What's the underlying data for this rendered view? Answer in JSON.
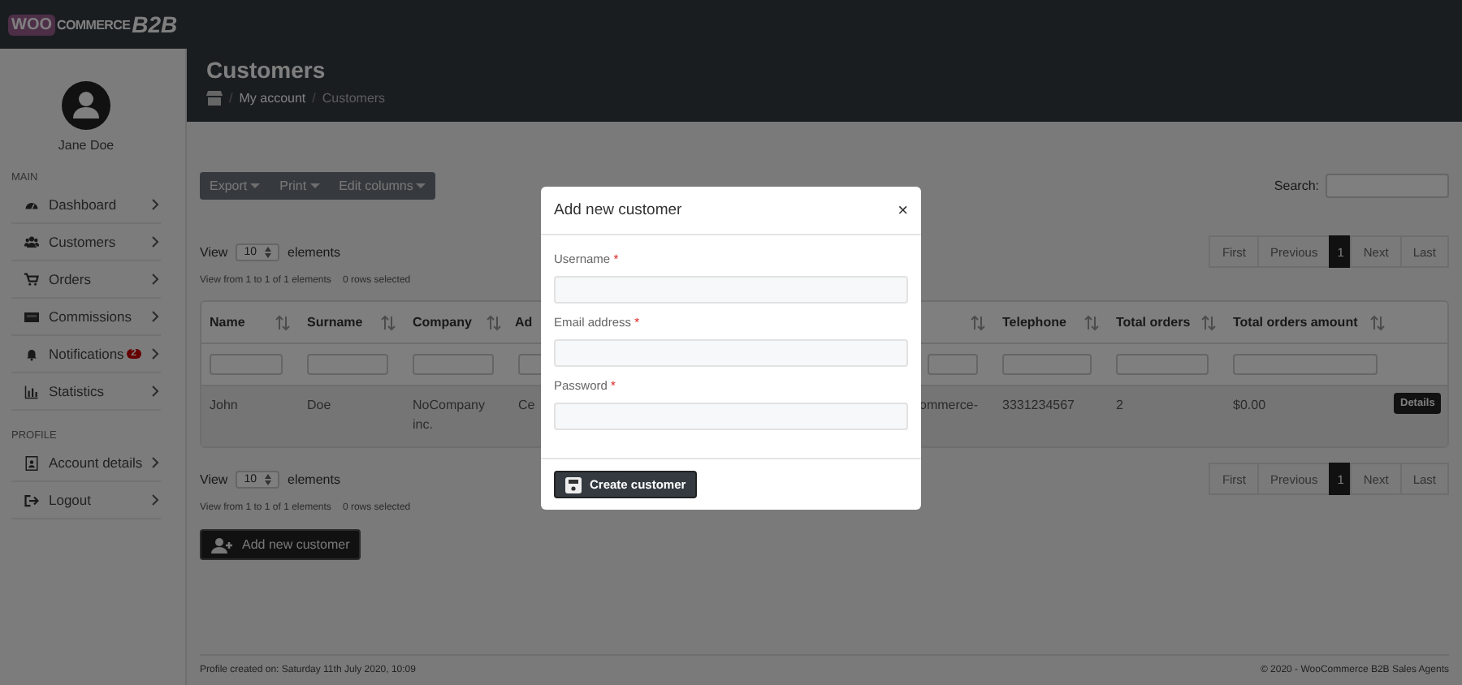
{
  "logo": {
    "brand": "WOO",
    "word": "COMMERCE",
    "suffix": "B2B"
  },
  "user": {
    "name": "Jane Doe"
  },
  "sidebar": {
    "sections": [
      {
        "label": "MAIN",
        "items": [
          {
            "label": "Dashboard"
          },
          {
            "label": "Customers"
          },
          {
            "label": "Orders"
          },
          {
            "label": "Commissions"
          },
          {
            "label": "Notifications",
            "badge": "2"
          },
          {
            "label": "Statistics"
          }
        ]
      },
      {
        "label": "PROFILE",
        "items": [
          {
            "label": "Account details"
          },
          {
            "label": "Logout"
          }
        ]
      }
    ]
  },
  "page_header": {
    "title": "Customers",
    "breadcrumb": [
      {
        "separator": "/",
        "label": "My account",
        "current": false
      },
      {
        "separator": "/",
        "label": "Customers",
        "current": true
      }
    ]
  },
  "toolbar": [
    "Export",
    "Print",
    "Edit columns"
  ],
  "search": {
    "label": "Search:"
  },
  "table_controls": [
    {
      "view": "View",
      "value": "10",
      "suffix": "elements",
      "info": "View from 1 to 1 of 1 elements",
      "selection": "0 rows selected",
      "pagination": [
        {
          "label": "First",
          "selected": false
        },
        {
          "label": "Previous",
          "selected": false
        },
        {
          "label": "1",
          "selected": true
        },
        {
          "label": "Next",
          "selected": false
        },
        {
          "label": "Last",
          "selected": false
        }
      ]
    },
    {
      "view": "View",
      "value": "10",
      "suffix": "elements",
      "info": "View from 1 to 1 of 1 elements",
      "selection": "0 rows selected",
      "pagination": [
        {
          "label": "First",
          "selected": false
        },
        {
          "label": "Previous",
          "selected": false
        },
        {
          "label": "1",
          "selected": true
        },
        {
          "label": "Next",
          "selected": false
        },
        {
          "label": "Last",
          "selected": false
        }
      ]
    }
  ],
  "table": {
    "columns": [
      {
        "label": "Name",
        "sortable": true
      },
      {
        "label": "Surname",
        "sortable": true
      },
      {
        "label": "Company",
        "sortable": true
      },
      {
        "label": "Ad",
        "sortable": false
      },
      {
        "sortable": true
      },
      {
        "label": "Telephone",
        "sortable": true
      },
      {
        "label": "Total orders",
        "sortable": true
      },
      {
        "label": "Total orders amount",
        "sortable": true
      }
    ],
    "rows": [
      {
        "cells": [
          "John",
          "Doe",
          "NoCompany inc.",
          "Ce",
          "ommerce-",
          "3331234567",
          "2",
          "$0.00"
        ],
        "action": "Details"
      }
    ]
  },
  "add_button": "Add new customer",
  "footer": {
    "left": "Profile created on: Saturday 11th July 2020, 10:09",
    "right": "© 2020 - WooCommerce B2B Sales Agents"
  },
  "modal": {
    "title": "Add new customer",
    "close": "×",
    "fields": [
      {
        "label": "Username",
        "required_mark": "*"
      },
      {
        "label": "Email address",
        "required_mark": "*"
      },
      {
        "label": "Password",
        "required_mark": "*"
      }
    ],
    "submit": "Create customer"
  }
}
